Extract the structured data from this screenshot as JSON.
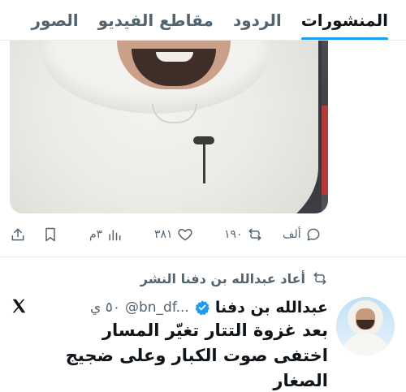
{
  "tabs": [
    {
      "label": "المنشورات",
      "active": true
    },
    {
      "label": "الردود",
      "active": false
    },
    {
      "label": "مقاطع الفيديو",
      "active": false
    },
    {
      "label": "الصور",
      "active": false
    }
  ],
  "post_actions": {
    "reply_count": "ألف",
    "repost_count": "١٩٠",
    "like_count": "٣٨١",
    "views_count": "٣م"
  },
  "repost_line": {
    "text": "أعاد عبدالله بن دفنا النشر",
    "icon": "repost-icon"
  },
  "post": {
    "author_name": "عبدالله بن دفنا",
    "verified": true,
    "handle": "@bn_df...",
    "time": "٥٠ ي",
    "text_lines": [
      "بعد غزوة التتار تغيّر المسار",
      "اختفى صوت الكبار وعلى ضجيج",
      "الصغار"
    ]
  },
  "colors": {
    "accent": "#1d9bf0",
    "secondary_text": "#536471",
    "primary_text": "#0f1419",
    "divider": "#e7e9ea"
  }
}
